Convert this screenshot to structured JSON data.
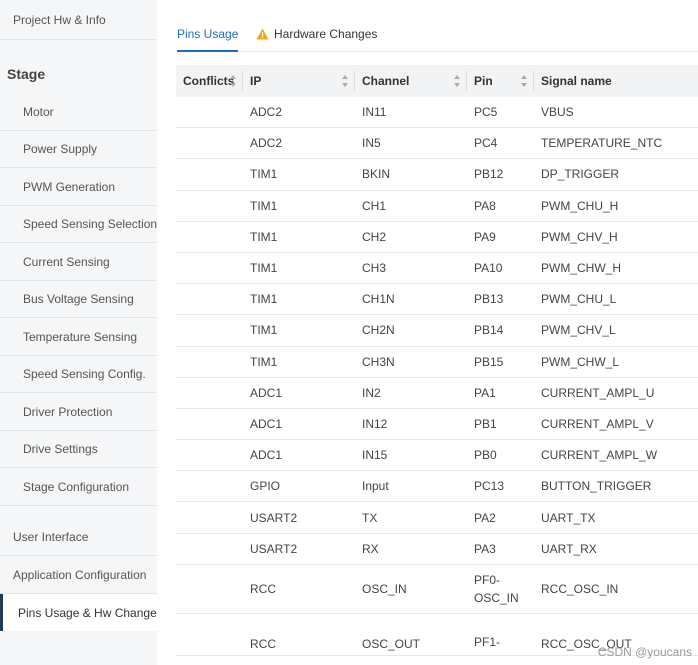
{
  "sidebar": {
    "project_item": "Project Hw & Info",
    "stage_header": "Stage",
    "stage_items": [
      "Motor",
      "Power Supply",
      "PWM Generation",
      "Speed Sensing Selection",
      "Current Sensing",
      "Bus Voltage Sensing",
      "Temperature Sensing",
      "Speed Sensing Config.",
      "Driver Protection",
      "Drive Settings",
      "Stage Configuration"
    ],
    "bottom_items": [
      "User Interface",
      "Application Configuration"
    ],
    "active_item": "Pins Usage & Hw Changes"
  },
  "tabs": {
    "pins_usage": "Pins Usage",
    "hardware_changes": "Hardware Changes"
  },
  "table": {
    "headers": [
      "Conflicts",
      "IP",
      "Channel",
      "Pin",
      "Signal name"
    ],
    "rows": [
      [
        "",
        "ADC2",
        "IN11",
        "PC5",
        "VBUS"
      ],
      [
        "",
        "ADC2",
        "IN5",
        "PC4",
        "TEMPERATURE_NTC"
      ],
      [
        "",
        "TIM1",
        "BKIN",
        "PB12",
        "DP_TRIGGER"
      ],
      [
        "",
        "TIM1",
        "CH1",
        "PA8",
        "PWM_CHU_H"
      ],
      [
        "",
        "TIM1",
        "CH2",
        "PA9",
        "PWM_CHV_H"
      ],
      [
        "",
        "TIM1",
        "CH3",
        "PA10",
        "PWM_CHW_H"
      ],
      [
        "",
        "TIM1",
        "CH1N",
        "PB13",
        "PWM_CHU_L"
      ],
      [
        "",
        "TIM1",
        "CH2N",
        "PB14",
        "PWM_CHV_L"
      ],
      [
        "",
        "TIM1",
        "CH3N",
        "PB15",
        "PWM_CHW_L"
      ],
      [
        "",
        "ADC1",
        "IN2",
        "PA1",
        "CURRENT_AMPL_U"
      ],
      [
        "",
        "ADC1",
        "IN12",
        "PB1",
        "CURRENT_AMPL_V"
      ],
      [
        "",
        "ADC1",
        "IN15",
        "PB0",
        "CURRENT_AMPL_W"
      ],
      [
        "",
        "GPIO",
        "Input",
        "PC13",
        "BUTTON_TRIGGER"
      ],
      [
        "",
        "USART2",
        "TX",
        "PA2",
        "UART_TX"
      ],
      [
        "",
        "USART2",
        "RX",
        "PA3",
        "UART_RX"
      ],
      [
        "",
        "RCC",
        "OSC_IN",
        "PF0-OSC_IN",
        "RCC_OSC_IN"
      ],
      [
        "",
        "RCC",
        "OSC_OUT",
        "PF1-",
        "RCC_OSC_OUT"
      ]
    ]
  },
  "watermark": "CSDN @youcans",
  "colors": {
    "accent": "#1a6fc0",
    "warning": "#f0a818",
    "active_border": "#1f3b57"
  },
  "icons": {
    "warning": "warning-triangle-icon",
    "sort": "sort-arrows-icon"
  }
}
